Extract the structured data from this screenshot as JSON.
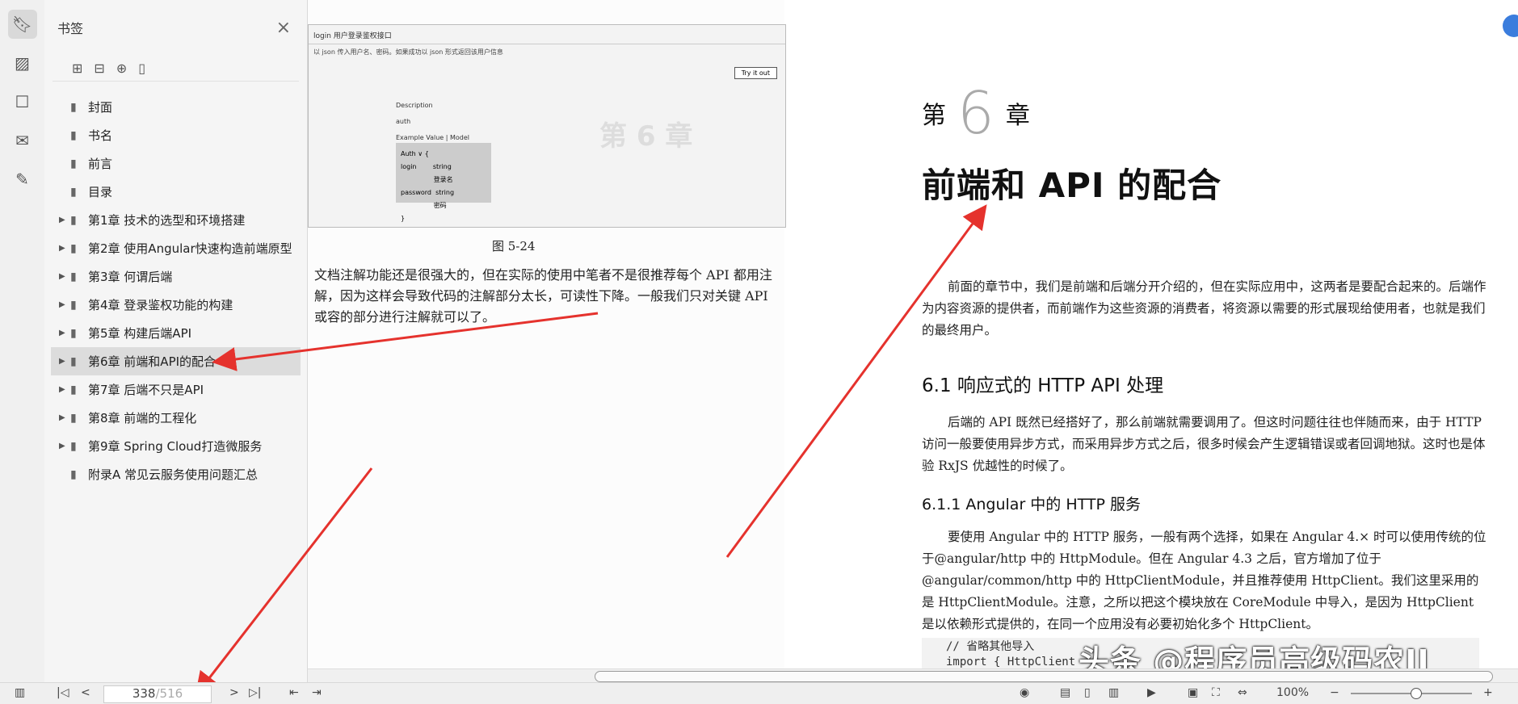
{
  "sidebar": {
    "title": "书签",
    "close_icon": "close-icon",
    "rail_icons": [
      "bookmark-icon",
      "image-icon",
      "comment-icon",
      "attachment-icon",
      "signature-icon"
    ],
    "tool_icons": [
      "expand-all-icon",
      "collapse-all-icon",
      "add-bookmark-icon",
      "bookmark-outline-icon"
    ],
    "items": [
      {
        "label": "封面",
        "expandable": false
      },
      {
        "label": "书名",
        "expandable": false
      },
      {
        "label": "前言",
        "expandable": false
      },
      {
        "label": "目录",
        "expandable": false
      },
      {
        "label": "第1章 技术的选型和环境搭建",
        "expandable": true
      },
      {
        "label": "第2章 使用Angular快速构造前端原型",
        "expandable": true
      },
      {
        "label": "第3章 何谓后端",
        "expandable": true
      },
      {
        "label": "第4章 登录鉴权功能的构建",
        "expandable": true
      },
      {
        "label": "第5章 构建后端API",
        "expandable": true
      },
      {
        "label": "第6章 前端和API的配合",
        "expandable": true,
        "selected": true
      },
      {
        "label": "第7章 后端不只是API",
        "expandable": true
      },
      {
        "label": "第8章 前端的工程化",
        "expandable": true
      },
      {
        "label": "第9章 Spring Cloud打造微服务",
        "expandable": true
      },
      {
        "label": "附录A 常见云服务使用问题汇总",
        "expandable": false
      }
    ]
  },
  "left_page": {
    "screenshot": {
      "endpoint": "login 用户登录鉴权接口",
      "sub": "以 json 传入用户名、密码。如果成功以 json 形式返回该用户信息",
      "try_button": "Try it out",
      "description_label": "Description",
      "description_value": "auth",
      "example_tabs": "Example Value | Model",
      "model_lines": [
        "Auth ∨ {",
        "login        string",
        "                登录名",
        "password  string",
        "                密码",
        "}"
      ],
      "ghost_text": "第 6 章"
    },
    "caption": "图 5-24",
    "text": "文档注解功能还是很强大的，但在实际的使用中笔者不是很推荐每个 API 都用注解，因为这样会导致代码的注解部分太长，可读性下降。一般我们只对关键 API 或容的部分进行注解就可以了。"
  },
  "right_page": {
    "chapter_prefix": "第",
    "chapter_num": "6",
    "chapter_suffix": "章",
    "chapter_title": "前端和 API 的配合",
    "intro": "前面的章节中，我们是前端和后端分开介绍的，但在实际应用中，这两者是要配合起来的。后端作为内容资源的提供者，而前端作为这些资源的消费者，将资源以需要的形式展现给使用者，也就是我们的最终用户。",
    "h2": "6.1  响应式的 HTTP API 处理",
    "p2": "后端的 API 既然已经搭好了，那么前端就需要调用了。但这时问题往往也伴随而来，由于 HTTP 访问一般要使用异步方式，而采用异步方式之后，很多时候会产生逻辑错误或者回调地狱。这时也是体验 RxJS 优越性的时候了。",
    "h3": "6.1.1  Angular 中的 HTTP 服务",
    "p3": "要使用 Angular 中的 HTTP 服务，一般有两个选择，如果在 Angular 4.× 时可以使用传统的位于@angular/http 中的 HttpModule。但在 Angular 4.3 之后，官方增加了位于@angular/common/http 中的 HttpClientModule，并且推荐使用 HttpClient。我们这里采用的是 HttpClientModule。注意，之所以把这个模块放在 CoreModule 中导入，是因为 HttpClient 是以依赖形式提供的，在同一个应用没有必要初始化多个 HttpClient。",
    "code_line1": "// 省略其他导入",
    "code_line2": "import { HttpClient"
  },
  "watermark": "头条 @程序员高级码农II",
  "statusbar": {
    "page_current": "338",
    "page_total": "/516",
    "zoom": "100%",
    "zoom_minus": "−",
    "zoom_plus": "+"
  }
}
